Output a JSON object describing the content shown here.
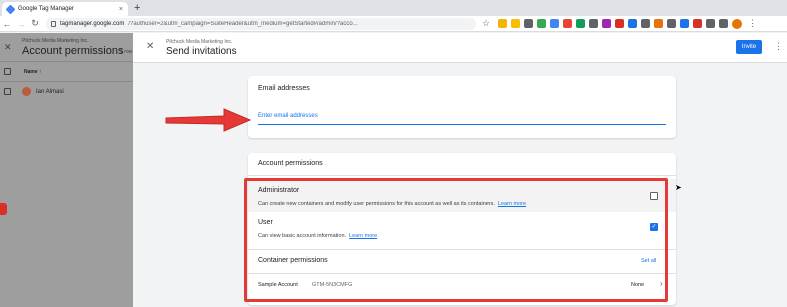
{
  "browser": {
    "tab_title": "Google Tag Manager",
    "tab_close": "×",
    "new_tab": "+",
    "url_host": "tagmanager.google.com",
    "url_path": "/?authuser=2&utm_campaign=SuiteHeader&utm_medium=getStarted#/admin/?acco...",
    "back": "←",
    "forward": "→",
    "reload": "↻",
    "star": "☆",
    "menu": "⋮",
    "extension_colors": [
      "#f4b400",
      "#fbbc04",
      "#5f6368",
      "#34a853",
      "#4285f4",
      "#ea4335",
      "#0f9d58",
      "#5f6368",
      "#9c27b0",
      "#d93025",
      "#1a73e8",
      "#5f6368",
      "#e8710a",
      "#5f6368",
      "#1a73e8",
      "#d93025",
      "#5f6368",
      "#5f6368"
    ]
  },
  "left_panel": {
    "close": "✕",
    "org": "Pilchuck Media Marketing Inc.",
    "title": "Account permissions",
    "count": "1 row",
    "column_name": "Name ↑",
    "user": "Ian Almasi"
  },
  "dialog": {
    "close": "✕",
    "org": "Pilchuck Media Marketing Inc.",
    "title": "Send invitations",
    "invite": "Invite",
    "menu": "⋮"
  },
  "email": {
    "title": "Email addresses",
    "placeholder": "Enter email addresses"
  },
  "permissions": {
    "title": "Account permissions",
    "admin_label": "Administrator",
    "admin_desc": "Can create new containers and modify user permissions for this account as well as its containers.",
    "learn_more": "Learn more",
    "user_label": "User",
    "user_desc": "Can view basic account information.",
    "user_checked": true,
    "admin_checked": false,
    "checkmark": "✓",
    "container_title": "Container permissions",
    "set_all": "Set all",
    "container_name": "Sample Account",
    "container_id": "GTM-5N3CMFG",
    "container_role": "None",
    "chevron": "›"
  },
  "colors": {
    "accent": "#1a73e8",
    "annotation": "#e53935"
  }
}
